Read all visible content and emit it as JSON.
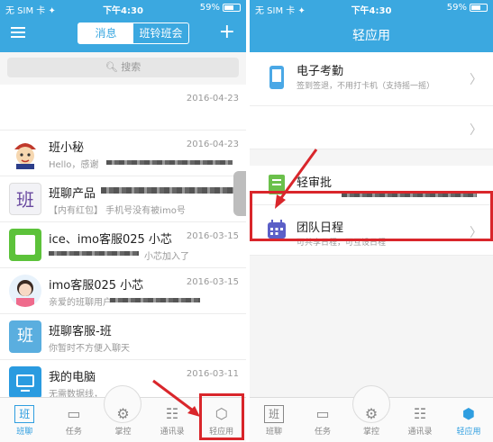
{
  "status": {
    "carrier": "无 SIM 卡 ✦",
    "time": "下午4:30",
    "battery": "59%"
  },
  "left": {
    "tabs": [
      "消息",
      "班铃班会"
    ],
    "search_placeholder": "搜索",
    "chats": [
      {
        "name": "",
        "preview": "",
        "date": "2016-04-23",
        "avatar": "blank"
      },
      {
        "name": "班小秘",
        "preview": "Hello，感谢",
        "date": "2016-04-23",
        "avatar": "cartoon"
      },
      {
        "name": "班聊产品",
        "preview": "【内有红包】 手机号没有被imo号",
        "date": "",
        "avatar": "ban-logo"
      },
      {
        "name": "ice、imo客服025 小芯",
        "preview": "",
        "date": "2016-03-15",
        "avatar": "green-group"
      },
      {
        "name": "imo客服025 小芯",
        "preview": "亲爱的班聊用户",
        "date": "2016-03-15",
        "avatar": "girl"
      },
      {
        "name": "班聊客服-班",
        "preview": "你暂时不方便入聊天",
        "date": "",
        "avatar": "ban-text"
      },
      {
        "name": "我的电脑",
        "preview": "无需数据线，",
        "date": "2016-03-11",
        "avatar": "computer"
      }
    ],
    "extra_preview": "小芯加入了",
    "tabbar": [
      "班聊",
      "任务",
      "掌控",
      "通讯录",
      "轻应用"
    ],
    "active_tab": "轻应用"
  },
  "right": {
    "title": "轻应用",
    "apps": [
      {
        "title": "电子考勤",
        "subtitle": "签到签退，不用打卡机（支持摇一摇）",
        "icon": "attendance-icon"
      },
      {
        "title": "",
        "subtitle": "",
        "icon": ""
      },
      {
        "title": "轻审批",
        "subtitle": "",
        "icon": "approval-icon"
      },
      {
        "title": "团队日程",
        "subtitle": "可共享日程，可互设日程",
        "icon": "calendar-icon"
      }
    ],
    "tabbar": [
      "班聊",
      "任务",
      "掌控",
      "通讯录",
      "轻应用"
    ],
    "active_tab": "轻应用"
  },
  "colors": {
    "primary": "#3ba8e0",
    "highlight": "#d9262b",
    "active_tab": "#2f9ee0"
  }
}
